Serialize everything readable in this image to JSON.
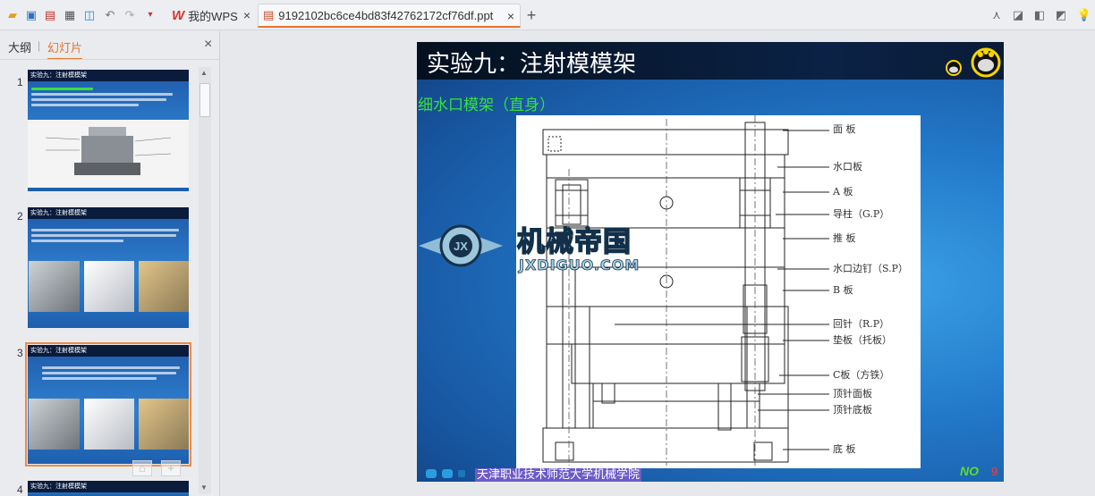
{
  "toolbar": {
    "icons": [
      "open-folder-icon",
      "save-icon",
      "export-pdf-icon",
      "print-icon",
      "print-preview-icon",
      "undo-icon",
      "redo-icon",
      "dropdown-icon"
    ],
    "right_icons": [
      "minimize-ribbon-icon",
      "skin-icon",
      "settings-icon",
      "bookmark-icon",
      "tip-icon"
    ]
  },
  "tabs": [
    {
      "label": "我的WPS",
      "icon": "wps-icon"
    },
    {
      "label": "9192102bc6ce4bd83f42762172cf76df.ppt",
      "icon": "ppt-file-icon"
    }
  ],
  "colors": {
    "accent": "#e8742b",
    "slide_title_bg": "#0b2246",
    "subtitle": "#39e13a",
    "slide_num": "#ff3b3b"
  },
  "panel": {
    "tab_outline": "大纲",
    "tab_slides": "幻灯片",
    "slides": [
      {
        "num": "1",
        "title": "实验九：注射模模架"
      },
      {
        "num": "2",
        "title": "实验九：注射模模架"
      },
      {
        "num": "3",
        "title": "实验九：注射模模架"
      },
      {
        "num": "4",
        "title": "实验九：注射模模架"
      }
    ]
  },
  "slide": {
    "title": "实验九：注射模模架",
    "subtitle": "细水口模架（直身）",
    "labels": [
      "面 板",
      "水口板",
      "A 板",
      "导柱（G.P）",
      "推 板",
      "水口边钉（S.P）",
      "B 板",
      "回针（R.P）",
      "垫板（托板）",
      "C板（方铁）",
      "顶针面板",
      "顶针底板",
      "底 板"
    ],
    "footer": "天津职业技术师范大学机械学院",
    "no_label": "NO",
    "number": "9"
  },
  "watermark": {
    "cn": "机械帝国",
    "en": "JXDIGUO.COM"
  }
}
